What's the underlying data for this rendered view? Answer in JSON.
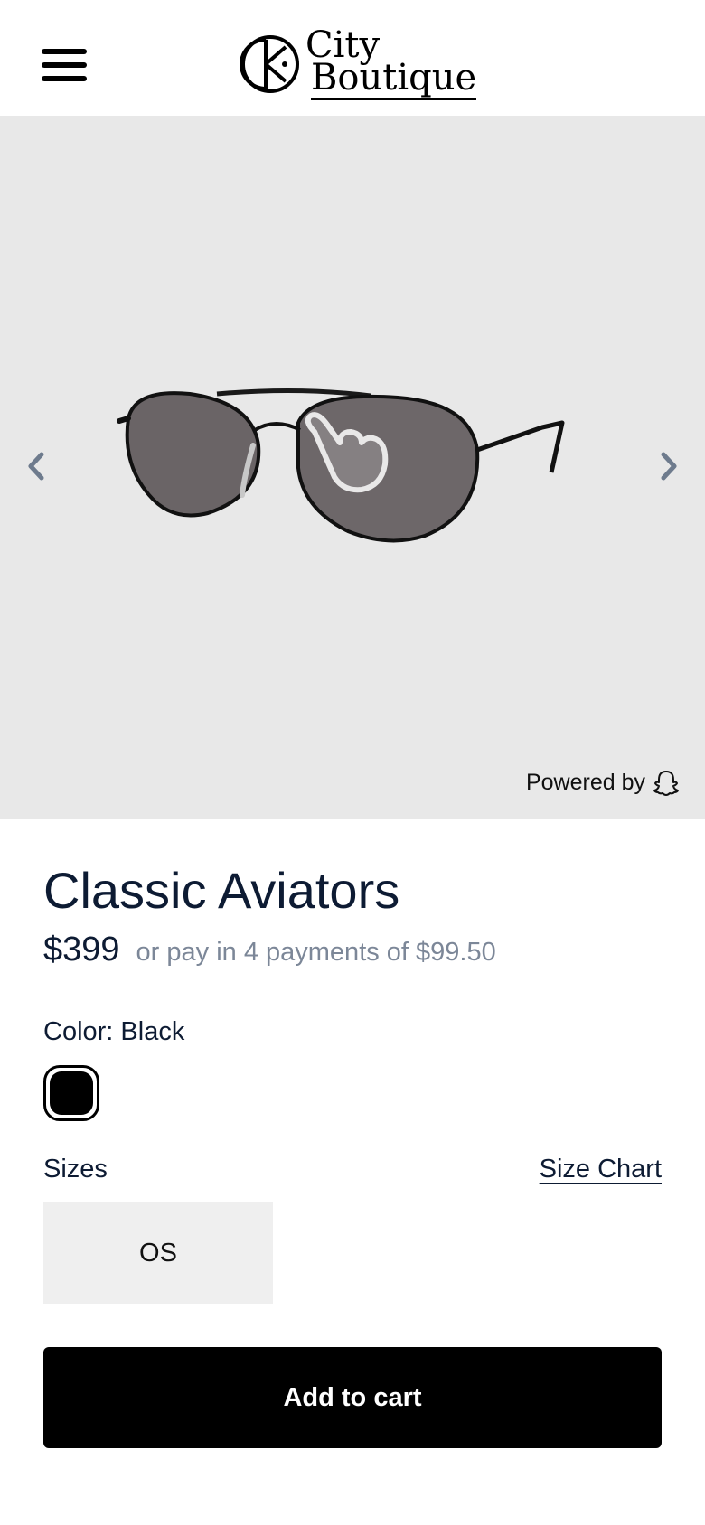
{
  "header": {
    "menu_icon": "hamburger-menu-icon",
    "logo_line1": "City",
    "logo_line2": "Boutique"
  },
  "viewer": {
    "left_arrow_icon": "chevron-left-icon",
    "right_arrow_icon": "chevron-right-icon",
    "image_subject": "aviator-sunglasses",
    "gesture_icon": "tap-hand-icon",
    "powered_by_label": "Powered by",
    "powered_by_icon": "snapchat-ghost-icon"
  },
  "product": {
    "title": "Classic Aviators",
    "price": "$399",
    "installments": "or pay in 4 payments of $99.50",
    "color_label": "Color: Black",
    "selected_color": "#000000",
    "sizes_label": "Sizes",
    "size_chart_label": "Size Chart",
    "sizes": [
      "OS"
    ],
    "add_to_cart_label": "Add to cart"
  },
  "colors": {
    "text_primary": "#0d1b33",
    "text_muted": "#7c8798",
    "viewer_bg": "#e8e8e8",
    "size_bg": "#efefef",
    "button_bg": "#000000"
  }
}
